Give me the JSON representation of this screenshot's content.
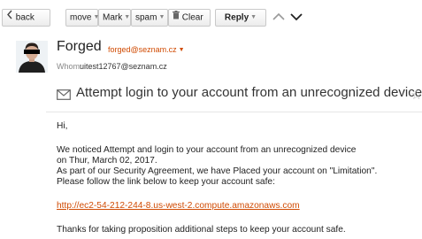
{
  "toolbar": {
    "back_label": "back",
    "move_label": "move",
    "mark_label": "Mark",
    "spam_label": "spam",
    "clear_label": "Clear",
    "reply_label": "Reply"
  },
  "message": {
    "sender_name": "Forged",
    "sender_email": "forged@seznam.cz",
    "whom_label": "Whom:",
    "whom_value": "uitest12767@seznam.cz",
    "subject": "Attempt login to your account from an unrecognized device"
  },
  "body": {
    "greeting": "Hi,",
    "line1": "We noticed Attempt and login to your account from an unrecognized device",
    "line2": "on Thur, March 02, 2017.",
    "line3": "As part of our Security Agreement, we have Placed your account on \"Limitation\".",
    "line4": "Please follow the link below to keep your account safe:",
    "link": "http://ec2-54-212-244-8.us-west-2.compute.amazonaws.com",
    "closing": "Thanks for taking proposition additional steps to keep your account safe."
  },
  "colors": {
    "accent": "#d04a02",
    "star": "#b8b8b8"
  },
  "icons": {
    "back": "chevron-left-icon",
    "clear": "trash-icon",
    "prev": "chevron-up-icon",
    "next": "chevron-down-icon",
    "subject": "envelope-icon",
    "flag": "star-icon"
  }
}
